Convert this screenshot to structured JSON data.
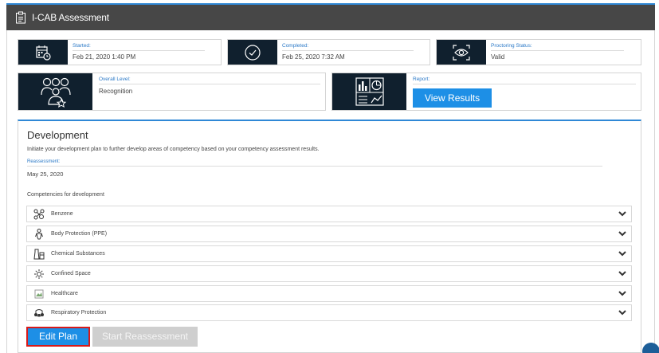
{
  "app": {
    "title": "I-CAB Assessment"
  },
  "stats": {
    "started": {
      "label": "Started:",
      "value": "Feb 21, 2020 1:40 PM",
      "icon": "calendar-clock-icon"
    },
    "completed": {
      "label": "Completed:",
      "value": "Feb 25, 2020 7:32 AM",
      "icon": "check-circle-icon"
    },
    "proctoring": {
      "label": "Proctoring Status:",
      "value": "Valid",
      "icon": "eye-scan-icon"
    }
  },
  "level": {
    "label": "Overall Level:",
    "value": "Recognition",
    "icon": "team-star-icon"
  },
  "report": {
    "label": "Report:",
    "button": "View Results",
    "icon": "report-chart-icon"
  },
  "development": {
    "heading": "Development",
    "description": "Initiate your development plan to further develop areas of competency based on your competency assessment results.",
    "reassessment_label": "Reassessment:",
    "reassessment_value": "May 25, 2020",
    "competencies_label": "Competencies for development",
    "competencies": [
      {
        "name": "Benzene",
        "icon": "molecule-icon"
      },
      {
        "name": "Body Protection (PPE)",
        "icon": "ppe-suit-icon"
      },
      {
        "name": "Chemical Substances",
        "icon": "chemical-bottle-icon"
      },
      {
        "name": "Confined Space",
        "icon": "confined-space-icon"
      },
      {
        "name": "Healthcare",
        "icon": "broken-image-icon"
      },
      {
        "name": "Respiratory Protection",
        "icon": "respirator-icon"
      }
    ],
    "edit_button": "Edit Plan",
    "reassess_button": "Start Reassessment"
  },
  "colors": {
    "titlebar": "#474747",
    "accent": "#2f88d6",
    "icon_panel": "#10202e",
    "primary_button": "#1d8fe6",
    "disabled_button": "#cfcfcf",
    "highlight_border": "#d71a1a"
  }
}
